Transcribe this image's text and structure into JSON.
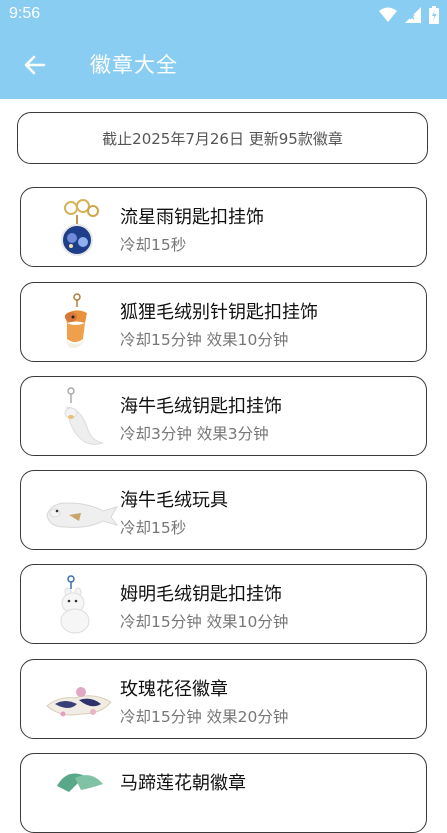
{
  "status": {
    "time": "9:56",
    "icons": [
      "wifi-icon",
      "cellular-signal-icon",
      "battery-icon"
    ]
  },
  "appbar": {
    "title": "徽章大全",
    "back_icon": "arrow-left-icon",
    "color": "#89CDF2"
  },
  "notice": "截止2025年7月26日 更新95款徽章",
  "badges": [
    {
      "name": "流星雨钥匙扣挂饰",
      "desc": "冷却15秒",
      "icon": "keychain-icon"
    },
    {
      "name": "狐狸毛绒别针钥匙扣挂饰",
      "desc": "冷却15分钟 效果10分钟",
      "icon": "fox-plush-icon"
    },
    {
      "name": "海牛毛绒钥匙扣挂饰",
      "desc": "冷却3分钟 效果3分钟",
      "icon": "manatee-keychain-icon"
    },
    {
      "name": "海牛毛绒玩具",
      "desc": "冷却15秒",
      "icon": "manatee-plush-icon"
    },
    {
      "name": "姆明毛绒钥匙扣挂饰",
      "desc": "冷却15分钟 效果10分钟",
      "icon": "moomin-plush-icon"
    },
    {
      "name": "玫瑰花径徽章",
      "desc": "冷却15分钟 效果20分钟",
      "icon": "rose-badge-icon"
    },
    {
      "name": "马蹄莲花朝徽章",
      "desc": "",
      "icon": "calla-lily-badge-icon"
    }
  ]
}
